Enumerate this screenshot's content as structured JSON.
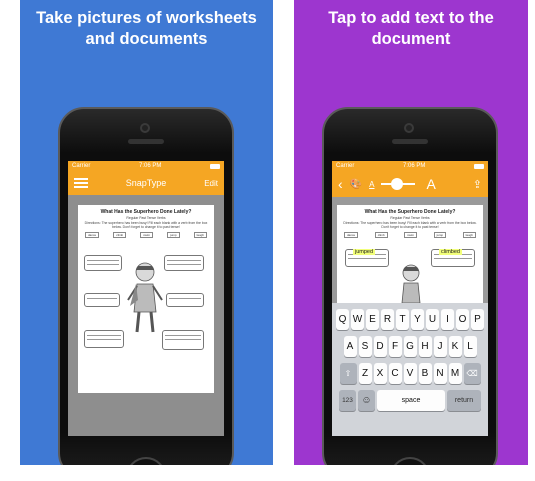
{
  "left_panel": {
    "headline": "Take pictures of worksheets\nand documents",
    "background": "#3f79d4",
    "status": {
      "carrier": "Carrier",
      "time": "7:06 PM"
    },
    "navbar": {
      "title": "SnapType",
      "edit_label": "Edit"
    },
    "document": {
      "title": "What Has the Superhero Done Lately?",
      "subtitle": "Regular Past Tense Verbs",
      "directions": "Directions: The superhero has been busy! Fill each blank with a verb from the box below. Don't forget to change it to past tense!",
      "words": [
        "dance",
        "climb",
        "swim",
        "jump",
        "laugh"
      ]
    }
  },
  "right_panel": {
    "headline": "Tap to add text to the\ndocument",
    "background": "#9d36cf",
    "status": {
      "carrier": "Carrier",
      "time": "7:06 PM"
    },
    "toolbar": {
      "back": "‹",
      "palette": "🎨",
      "small_a": "A",
      "big_a": "A",
      "share": "⇪"
    },
    "document": {
      "title": "What Has the Superhero Done Lately?",
      "subtitle": "Regular Past Tense Verbs",
      "directions": "Directions: The superhero has been busy! Fill each blank with a verb from the box below. Don't forget to change it to past tense!",
      "words": [
        "dance",
        "climb",
        "swim",
        "jump",
        "laugh"
      ],
      "answer1": "jumped",
      "answer2": "climbed"
    },
    "keyboard": {
      "row1": [
        "Q",
        "W",
        "E",
        "R",
        "T",
        "Y",
        "U",
        "I",
        "O",
        "P"
      ],
      "row2": [
        "A",
        "S",
        "D",
        "F",
        "G",
        "H",
        "J",
        "K",
        "L"
      ],
      "row3": [
        "Z",
        "X",
        "C",
        "V",
        "B",
        "N",
        "M"
      ],
      "shift": "⇧",
      "delete": "⌫",
      "numbers": "123",
      "emoji": "☺",
      "space": "space",
      "return": "return"
    }
  },
  "accent_orange": "#f5a623"
}
